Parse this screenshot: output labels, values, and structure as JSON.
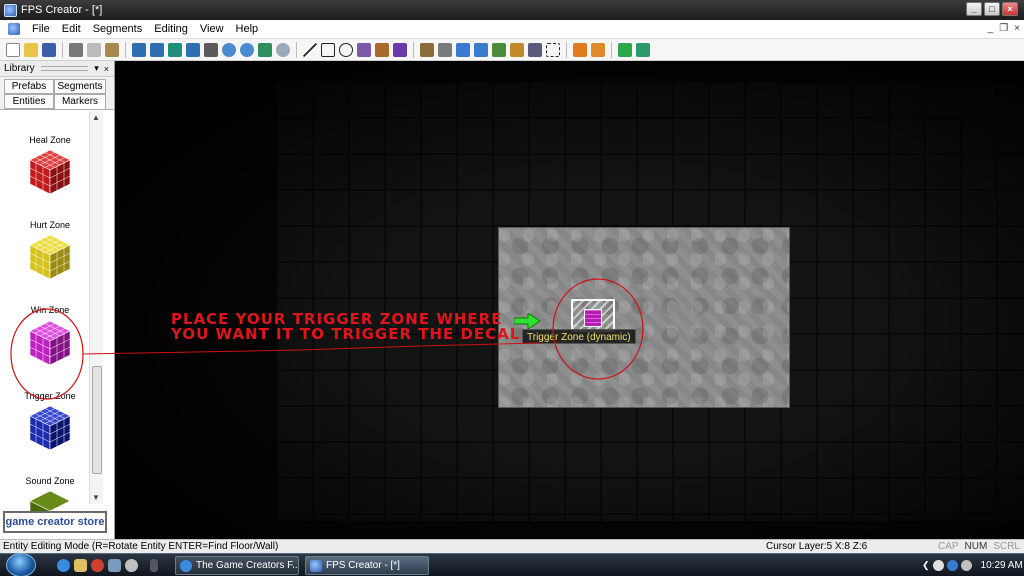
{
  "window": {
    "title": "FPS Creator - [*]"
  },
  "menu": {
    "items": [
      "File",
      "Edit",
      "Segments",
      "Editing",
      "View",
      "Help"
    ]
  },
  "library": {
    "title": "Library",
    "tabs": [
      "Prefabs",
      "Segments",
      "Entities",
      "Markers"
    ],
    "items": [
      {
        "label": "Heal Zone",
        "color": "#2a9a2a"
      },
      {
        "label": "Hurt Zone",
        "color": "#c41a1a"
      },
      {
        "label": "Win Zone",
        "color": "#d6c21a"
      },
      {
        "label": "Trigger Zone",
        "color": "#c021c0"
      },
      {
        "label": "Sound Zone",
        "color": "#1a2ab0"
      },
      {
        "label": "",
        "color": "#4a6a0a"
      }
    ],
    "store_button": "game creator store"
  },
  "viewport": {
    "annotation_line1": "PLACE YOUR TRIGGER ZONE WHERE",
    "annotation_line2": "YOU WANT IT TO TRIGGER THE DECAL",
    "tooltip": "Trigger Zone (dynamic)"
  },
  "status": {
    "mode": "Entity Editing Mode (R=Rotate Entity  ENTER=Find Floor/Wall)",
    "cursor": "Cursor Layer:5  X:8  Z:6",
    "keys": [
      "CAP",
      "NUM",
      "SCRL"
    ]
  },
  "taskbar": {
    "tasks": [
      "The Game Creators F...",
      "FPS Creator - [*]"
    ],
    "clock": "10:29 AM"
  },
  "colors": {
    "annotation": "#e0151c",
    "tooltip_text": "#f3e36a",
    "highlight_circle": "#d01010"
  }
}
